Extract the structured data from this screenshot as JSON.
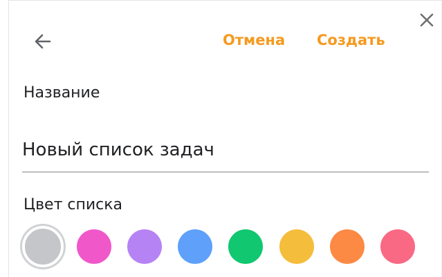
{
  "dialog": {
    "back_icon": "arrow-left-icon",
    "close_icon": "close-icon",
    "cancel_label": "Отмена",
    "create_label": "Создать",
    "accent_color": "#f59a1f"
  },
  "form": {
    "name_label": "Название",
    "name_value": "Новый список задач",
    "color_label": "Цвет списка"
  },
  "colors": [
    {
      "name": "gray",
      "hex": "#c4c6c9",
      "selected": true
    },
    {
      "name": "pink",
      "hex": "#f057c9",
      "selected": false
    },
    {
      "name": "purple",
      "hex": "#b683f4",
      "selected": false
    },
    {
      "name": "blue",
      "hex": "#5ea0fa",
      "selected": false
    },
    {
      "name": "green",
      "hex": "#11c76f",
      "selected": false
    },
    {
      "name": "yellow",
      "hex": "#f4bd3b",
      "selected": false
    },
    {
      "name": "orange",
      "hex": "#fc8a45",
      "selected": false
    },
    {
      "name": "red",
      "hex": "#fa6984",
      "selected": false
    }
  ]
}
